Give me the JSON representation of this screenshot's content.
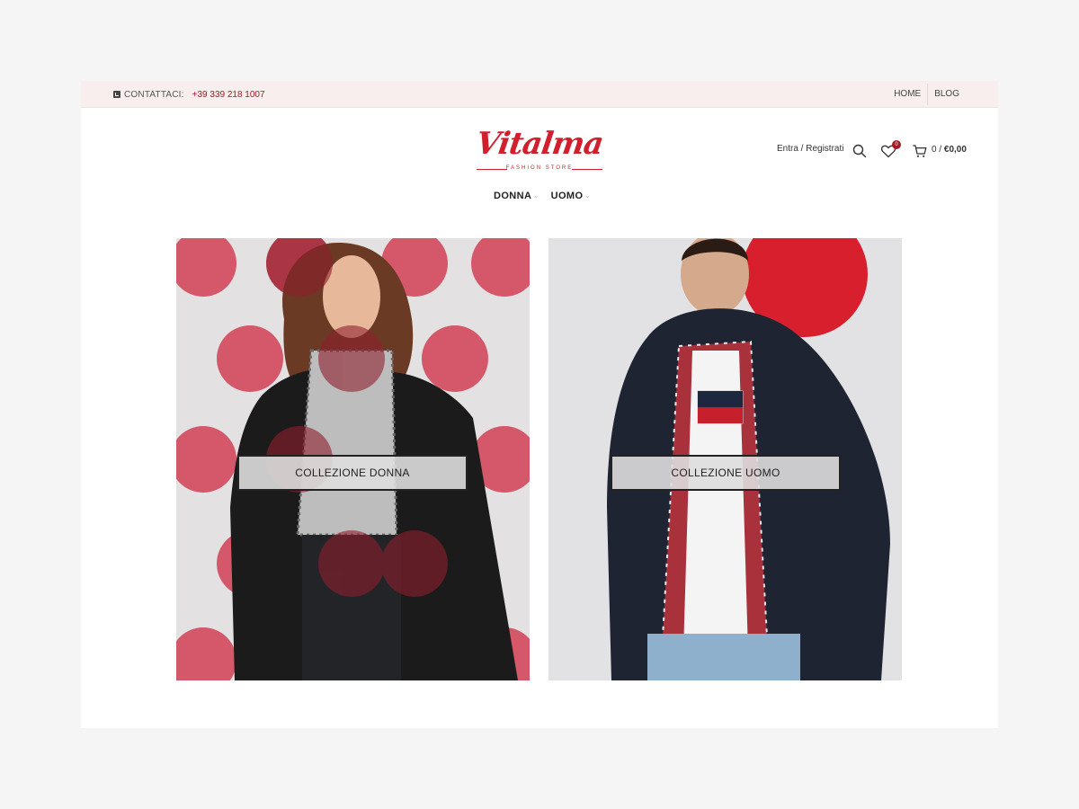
{
  "topbar": {
    "contact_label": "CONTATTACI:",
    "phone": "+39 339 218 1007",
    "links": [
      "HOME",
      "BLOG"
    ]
  },
  "header": {
    "logo_text": "Vitalma",
    "logo_subtitle": "FASHION STORE",
    "account_label": "Entra / Registrati",
    "wishlist_count": "0",
    "cart_count": "0 /",
    "cart_total": "€0,00",
    "icons": [
      "search-icon",
      "heart-icon",
      "cart-icon"
    ]
  },
  "nav": {
    "items": [
      {
        "label": "DONNA"
      },
      {
        "label": "UOMO"
      }
    ]
  },
  "banners": [
    {
      "button_label": "COLLEZIONE DONNA"
    },
    {
      "button_label": "COLLEZIONE UOMO"
    }
  ],
  "colors": {
    "brand_red": "#d21f2e",
    "accent_dark_red": "#a11a24",
    "topbar_bg": "#f8eeee"
  }
}
